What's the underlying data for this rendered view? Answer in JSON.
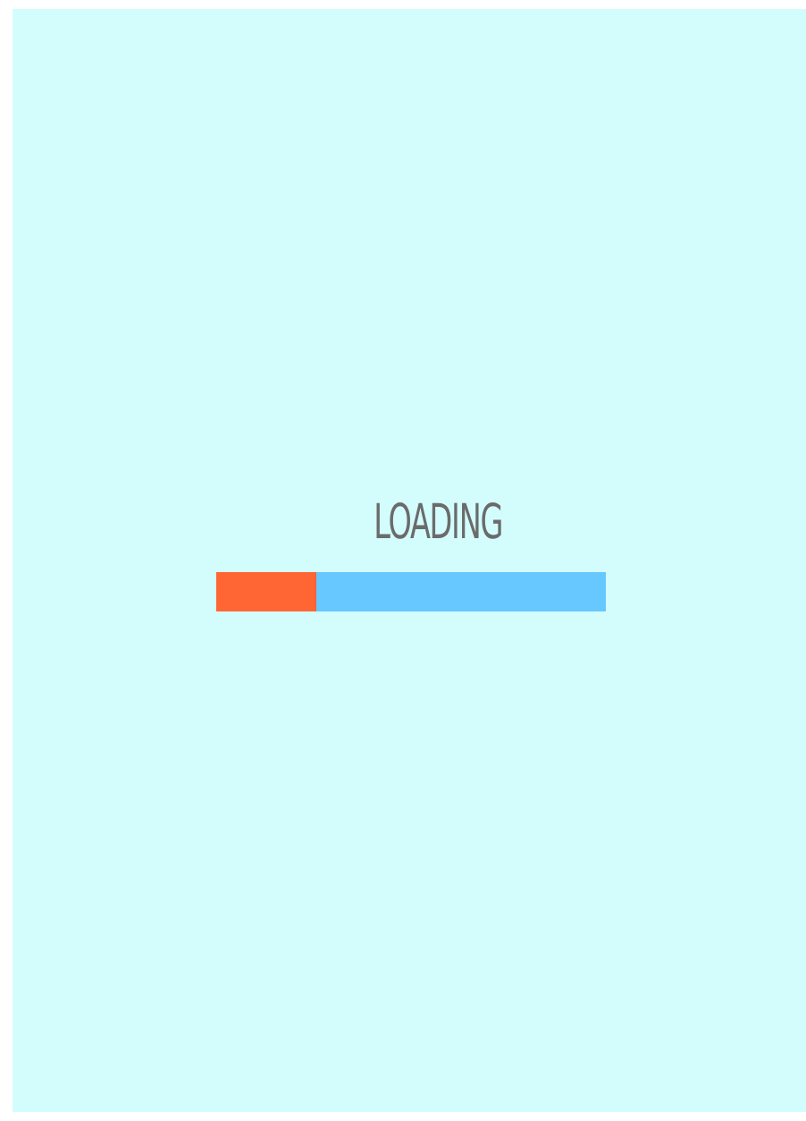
{
  "loading": {
    "label": "LOADING",
    "level": 0.26
  }
}
